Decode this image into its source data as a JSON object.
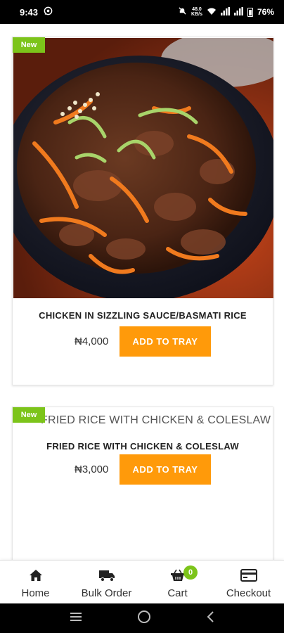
{
  "status_bar": {
    "time": "9:43",
    "network_speed_top": "48.0",
    "network_speed_bottom": "KB/s",
    "battery": "76%"
  },
  "products": [
    {
      "badge": "New",
      "title": "CHICKEN IN SIZZLING SAUCE/BASMATI RICE",
      "price": "₦4,000",
      "button": "ADD TO TRAY"
    },
    {
      "badge": "New",
      "image_alt": "FRIED RICE WITH CHICKEN & COLESLAW",
      "title": "FRIED RICE WITH CHICKEN & COLESLAW",
      "price": "₦3,000",
      "button": "ADD TO TRAY"
    }
  ],
  "bottom_nav": {
    "items": [
      {
        "label": "Home",
        "icon": "home-icon"
      },
      {
        "label": "Bulk Order",
        "icon": "truck-icon"
      },
      {
        "label": "Cart",
        "icon": "basket-icon"
      },
      {
        "label": "Checkout",
        "icon": "card-icon"
      }
    ],
    "cart_count": "0"
  },
  "colors": {
    "accent_orange": "#ff9a0a",
    "badge_green": "#7cc41a"
  }
}
